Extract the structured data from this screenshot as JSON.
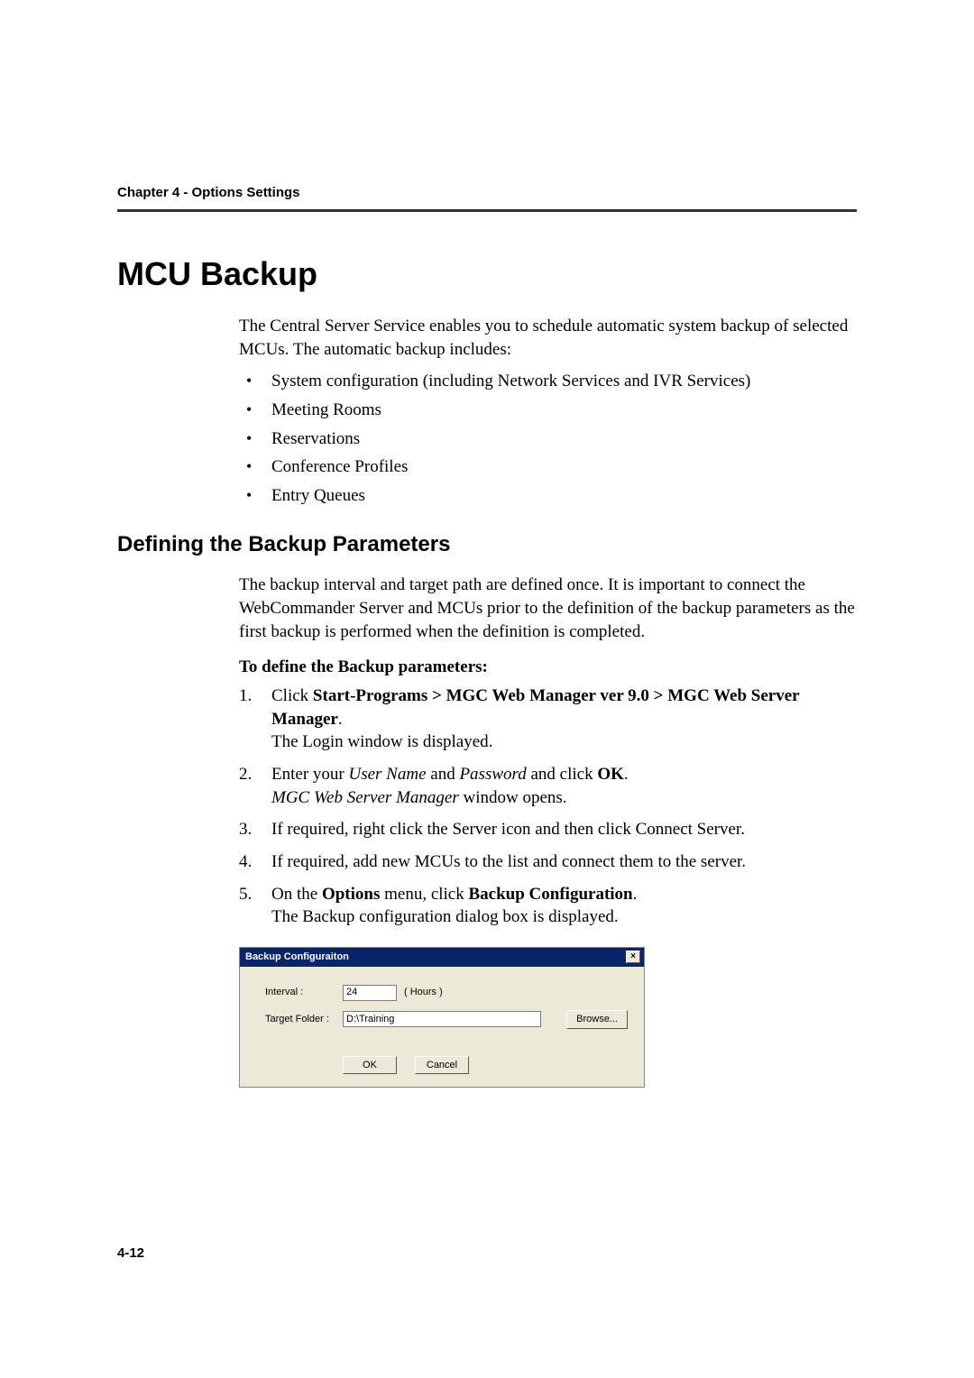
{
  "header": {
    "chapter": "Chapter 4 - Options Settings"
  },
  "title": "MCU Backup",
  "intro": "The Central Server Service enables you to schedule automatic system backup of selected MCUs. The automatic backup includes:",
  "bullets": [
    "System configuration (including Network Services and IVR Services)",
    "Meeting Rooms",
    "Reservations",
    "Conference Profiles",
    "Entry Queues"
  ],
  "section2": {
    "heading": "Defining the Backup Parameters",
    "para": "The backup interval and target path are defined once. It is important to connect the WebCommander Server and MCUs prior to the definition of the backup parameters as the first backup is performed when the definition is completed.",
    "subhead": "To define the Backup parameters:",
    "steps": {
      "s1_num": "1.",
      "s1_a": "Click ",
      "s1_b": "Start-Programs > MGC Web Manager ver 9.0 > MGC Web Server Manager",
      "s1_c": ".",
      "s1_line2": "The Login window is displayed.",
      "s2_num": "2.",
      "s2_a": "Enter your ",
      "s2_b": "User Name",
      "s2_c": " and ",
      "s2_d": "Password",
      "s2_e": " and click ",
      "s2_f": "OK",
      "s2_g": ".",
      "s2_line2a": "MGC Web Server Manager",
      "s2_line2b": " window opens.",
      "s3_num": "3.",
      "s3": "If required, right click the Server icon and then click Connect Server.",
      "s4_num": "4.",
      "s4": "If required, add new MCUs to the list and connect them to the server.",
      "s5_num": "5.",
      "s5_a": "On the ",
      "s5_b": "Options",
      "s5_c": " menu, click ",
      "s5_d": "Backup Configuration",
      "s5_e": ".",
      "s5_line2": "The Backup configuration dialog box is displayed."
    }
  },
  "dialog": {
    "title": "Backup Configuraiton",
    "close": "×",
    "interval_label": "Interval :",
    "interval_value": "24",
    "interval_unit": "( Hours )",
    "target_label": "Target Folder :",
    "target_value": "D:\\Training",
    "browse": "Browse...",
    "ok": "OK",
    "cancel": "Cancel"
  },
  "footer": {
    "page": "4-12"
  }
}
